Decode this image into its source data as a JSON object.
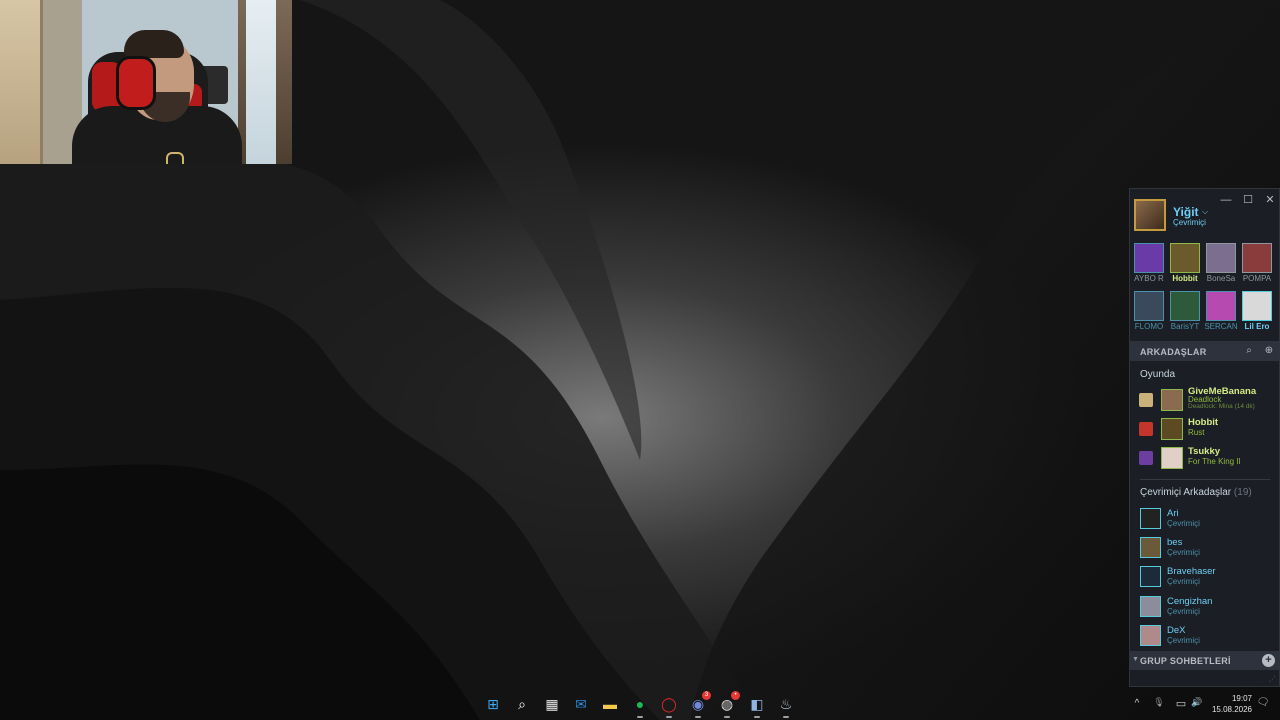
{
  "desktop": {
    "wallpaper": "dark-gray-gradient-dunes",
    "colors": {
      "base": "#0d0d0d",
      "highlight": "#8a8a8a"
    }
  },
  "webcam": {
    "icon": "webcam-person-video"
  },
  "steam": {
    "window_controls": {
      "minimize": "—",
      "maximize": "☐",
      "close": "✕"
    },
    "self": {
      "name": "Yiğit",
      "status": "Çevrimiçi",
      "caret": "⌵",
      "icon": "self-avatar"
    },
    "favorites": [
      {
        "label": "AYBO R",
        "color": "#8f98a0",
        "avatar_color": "#6a3aa8",
        "border": "#4c91ac"
      },
      {
        "label": "Hobbit",
        "color": "#d6ec86",
        "avatar_color": "#6b5b2c",
        "border": "#8fb94a"
      },
      {
        "label": "BoneSa",
        "color": "#8f98a0",
        "avatar_color": "#7a6f8e",
        "border": "#8f98a0"
      },
      {
        "label": "POMPA",
        "color": "#8f98a0",
        "avatar_color": "#8a3b3b",
        "border": "#8f98a0"
      },
      {
        "label": "FLOMO",
        "color": "#4c91ac",
        "avatar_color": "#3a4a5c",
        "border": "#4c91ac"
      },
      {
        "label": "BarisYT",
        "color": "#4c91ac",
        "avatar_color": "#2e5a3a",
        "border": "#4c91ac"
      },
      {
        "label": "SERCAN",
        "color": "#4c91ac",
        "avatar_color": "#b64ab0",
        "border": "#4c91ac"
      },
      {
        "label": "Lil Ero",
        "color": "#6dcff6",
        "avatar_color": "#d9d9d9",
        "border": "#57cbde"
      }
    ],
    "friends_header": {
      "label": "ARKADAŞLAR",
      "search_icon": "⌕",
      "add_icon": "⊕"
    },
    "ingame": {
      "title": "Oyunda",
      "rows": [
        {
          "name": "GiveMeBanana",
          "game": "Deadlock",
          "detail": "Deadlock: Mina (14 dk)",
          "icon_color": "#c9b27a",
          "avatar_color": "#8a6b50"
        },
        {
          "name": "Hobbit",
          "game": "Rust",
          "detail": "",
          "icon_color": "#c4352a",
          "avatar_color": "#5b4a22"
        },
        {
          "name": "Tsukky",
          "game": "For The King II",
          "detail": "",
          "icon_color": "#6b3fa0",
          "avatar_color": "#e0d0c8"
        }
      ]
    },
    "online": {
      "title": "Çevrimiçi Arkadaşlar",
      "count": "(19)",
      "rows": [
        {
          "name": "Ari",
          "status": "Çevrimiçi",
          "avatar_color": "#222222"
        },
        {
          "name": "bes",
          "status": "Çevrimiçi",
          "avatar_color": "#6b5a3a"
        },
        {
          "name": "Bravehaser",
          "status": "Çevrimiçi",
          "avatar_color": "#1c2a3a"
        },
        {
          "name": "Cengizhan",
          "status": "Çevrimiçi",
          "avatar_color": "#8c8c9a"
        },
        {
          "name": "DeX",
          "status": "Çevrimiçi",
          "avatar_color": "#b08a8a"
        }
      ]
    },
    "group_bar": {
      "label": "GRUP SOHBETLERİ",
      "caret": "▼",
      "add_icon": "+"
    },
    "resize_icon": "⋰"
  },
  "taskbar": {
    "icons": [
      {
        "name": "windows-start-icon",
        "glyph": "⊞",
        "color": "#3fa9f5",
        "dot": false
      },
      {
        "name": "search-icon",
        "glyph": "⌕",
        "color": "#ffffff",
        "dot": false
      },
      {
        "name": "microsoft-store-icon",
        "glyph": "▦",
        "color": "#e7e7e7",
        "dot": false
      },
      {
        "name": "outlook-icon",
        "glyph": "✉",
        "color": "#2b88d8",
        "dot": false
      },
      {
        "name": "file-explorer-icon",
        "glyph": "▬",
        "color": "#f2c94c",
        "dot": false
      },
      {
        "name": "spotify-icon",
        "glyph": "●",
        "color": "#1db954",
        "dot": true
      },
      {
        "name": "opera-icon",
        "glyph": "◯",
        "color": "#e0282c",
        "dot": true
      },
      {
        "name": "discord-icon",
        "glyph": "◉",
        "color": "#7289da",
        "dot": true,
        "badge": "3"
      },
      {
        "name": "obs-icon",
        "glyph": "◍",
        "color": "#dddddd",
        "dot": true,
        "badge": "•"
      },
      {
        "name": "snipping-tool-icon",
        "glyph": "◧",
        "color": "#8fb3e3",
        "dot": true
      },
      {
        "name": "steam-icon",
        "glyph": "♨",
        "color": "#c7d5e0",
        "dot": true
      }
    ],
    "tray": {
      "chevron": "^",
      "mic": "🎙",
      "network": "▭",
      "volume": "🔊"
    },
    "clock": {
      "time": "19:07",
      "date": "15.08.2026"
    },
    "notification_icon": "🗨"
  }
}
